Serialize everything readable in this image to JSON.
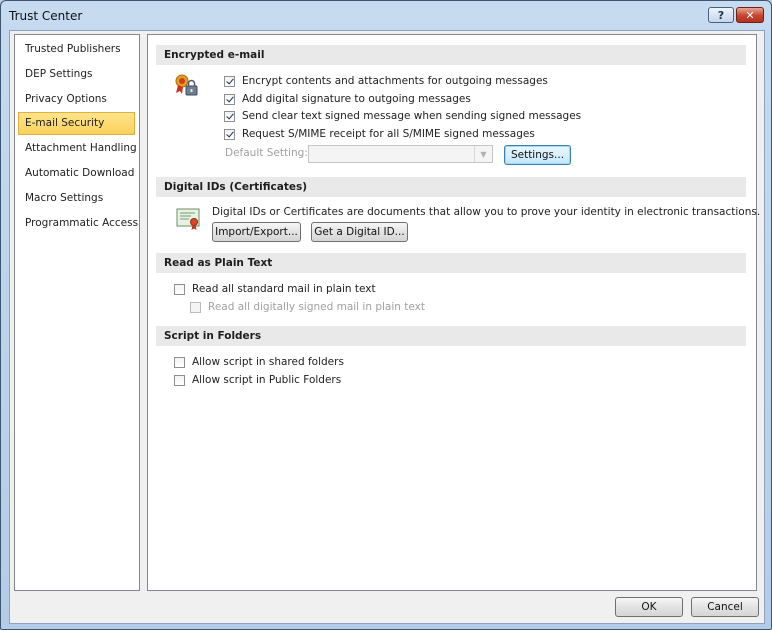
{
  "window": {
    "title": "Trust Center",
    "help_glyph": "?",
    "close_glyph": "✕"
  },
  "nav": {
    "items": [
      {
        "label": "Trusted Publishers",
        "selected": false
      },
      {
        "label": "DEP Settings",
        "selected": false
      },
      {
        "label": "Privacy Options",
        "selected": false
      },
      {
        "label": "E-mail Security",
        "selected": true
      },
      {
        "label": "Attachment Handling",
        "selected": false
      },
      {
        "label": "Automatic Download",
        "selected": false
      },
      {
        "label": "Macro Settings",
        "selected": false
      },
      {
        "label": "Programmatic Access",
        "selected": false
      }
    ]
  },
  "encrypted": {
    "heading": "Encrypted e-mail",
    "options": [
      {
        "label": "Encrypt contents and attachments for outgoing messages",
        "checked": true
      },
      {
        "label": "Add digital signature to outgoing messages",
        "checked": true
      },
      {
        "label": "Send clear text signed message when sending signed messages",
        "checked": true
      },
      {
        "label": "Request S/MIME receipt for all S/MIME signed messages",
        "checked": true
      }
    ],
    "default_setting_label": "Default Setting:",
    "default_setting_value": "",
    "settings_button": "Settings..."
  },
  "digital_ids": {
    "heading": "Digital IDs (Certificates)",
    "description": "Digital IDs or Certificates are documents that allow you to prove your identity in electronic transactions.",
    "import_export_button": "Import/Export...",
    "get_digital_id_button": "Get a Digital ID..."
  },
  "plain_text": {
    "heading": "Read as Plain Text",
    "read_all_standard": {
      "label": "Read all standard mail in plain text",
      "checked": false
    },
    "read_all_signed": {
      "label": "Read all digitally signed mail in plain text",
      "checked": false,
      "disabled": true
    }
  },
  "script": {
    "heading": "Script in Folders",
    "shared": {
      "label": "Allow script in shared folders",
      "checked": false
    },
    "public": {
      "label": "Allow script in Public Folders",
      "checked": false
    }
  },
  "footer": {
    "ok_button": "OK",
    "cancel_button": "Cancel"
  },
  "colors": {
    "selected_nav_bg": "#fbd25c",
    "section_header_bg": "#e9e9e9",
    "title_bar": "#c6dbf0",
    "close_button": "#c8432c"
  }
}
